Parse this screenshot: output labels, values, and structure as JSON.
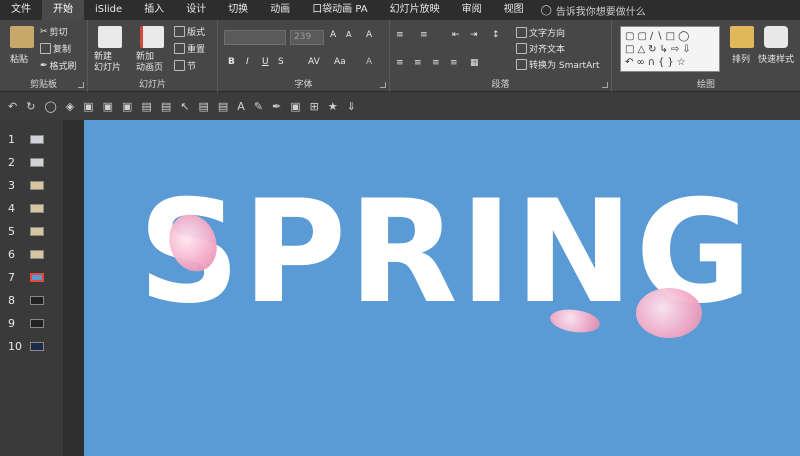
{
  "menubar": {
    "tabs": [
      "文件",
      "开始",
      "iSlide",
      "插入",
      "设计",
      "切换",
      "动画",
      "口袋动画 PA",
      "幻灯片放映",
      "审阅",
      "视图"
    ],
    "active": "开始",
    "tell_me": "告诉我你想要做什么"
  },
  "ribbon": {
    "clipboard": {
      "paste": "粘贴",
      "cut": "剪切",
      "copy": "复制",
      "format_painter": "格式刷",
      "label": "剪贴板"
    },
    "slides": {
      "new_slide": "新建\n幻灯片",
      "new_anim_page": "新加\n动画页",
      "layout": "版式",
      "reset": "重置",
      "section": "节",
      "label": "幻灯片"
    },
    "font": {
      "size": "239",
      "label": "字体",
      "bold": "B",
      "italic": "I",
      "underline": "U",
      "strike": "S",
      "aa": "Aa",
      "grow": "A",
      "shrink": "A",
      "clear": "A"
    },
    "paragraph": {
      "text_direction": "文字方向",
      "align_text": "对齐文本",
      "smartart": "转换为 SmartArt",
      "label": "段落"
    },
    "drawing": {
      "arrange": "排列",
      "quick_styles": "快速样式",
      "label": "绘图"
    }
  },
  "thumbnails": [
    "1",
    "2",
    "3",
    "4",
    "5",
    "6",
    "7",
    "8",
    "9",
    "10"
  ],
  "selected_slide": "7",
  "slide": {
    "text": "SPRING",
    "background": "#5b9bd5"
  }
}
